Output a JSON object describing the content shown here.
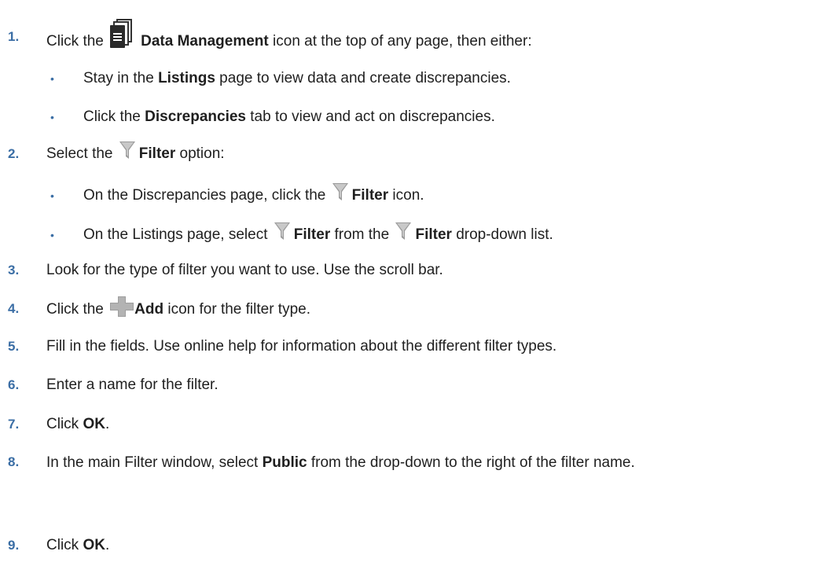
{
  "steps": [
    {
      "num": "1.",
      "pre": "Click the ",
      "icon": "data-management-icon",
      "bold": "Data Management",
      "post": " icon at the top of any page, then either:",
      "subs": [
        {
          "pre": "Stay in the ",
          "bold": "Listings",
          "post": " page to view data and create discrepancies."
        },
        {
          "pre": "Click the ",
          "bold": "Discrepancies",
          "post": " tab to view and act on discrepancies."
        }
      ]
    },
    {
      "num": "2.",
      "pre": "Select the ",
      "icon": "filter-icon",
      "bold": "Filter",
      "post": " option:",
      "subs": [
        {
          "pre": "On the Discrepancies page, click the ",
          "icon": "filter-icon",
          "bold": "Filter",
          "post": " icon."
        },
        {
          "pre": "On the Listings page, select ",
          "icon": "filter-icon",
          "bold": "Filter",
          "mid": " from the ",
          "icon2": "filter-icon",
          "bold2": "Filter",
          "post": " drop-down list."
        }
      ]
    },
    {
      "num": "3.",
      "text": "Look for the type of filter you want to use. Use the scroll bar."
    },
    {
      "num": "4.",
      "pre": "Click the ",
      "icon": "add-icon",
      "bold": "Add",
      "post": " icon for the filter type."
    },
    {
      "num": "5.",
      "text": "Fill in the fields. Use online help for information about the different filter types."
    },
    {
      "num": "6.",
      "text": "Enter a name for the filter."
    },
    {
      "num": "7.",
      "pre": "Click ",
      "bold": "OK",
      "post": "."
    },
    {
      "num": "8.",
      "pre": "In the main Filter window, select ",
      "bold": "Public",
      "post": " from the drop-down to the right of the filter name."
    },
    {
      "num": "9.",
      "pre": "Click ",
      "bold": "OK",
      "post": "."
    }
  ],
  "bullet_char": "•",
  "colors": {
    "number": "#3b6ea5",
    "text": "#1f1f1f",
    "icon_gray": "#8c8c8c",
    "icon_dark": "#333333"
  }
}
